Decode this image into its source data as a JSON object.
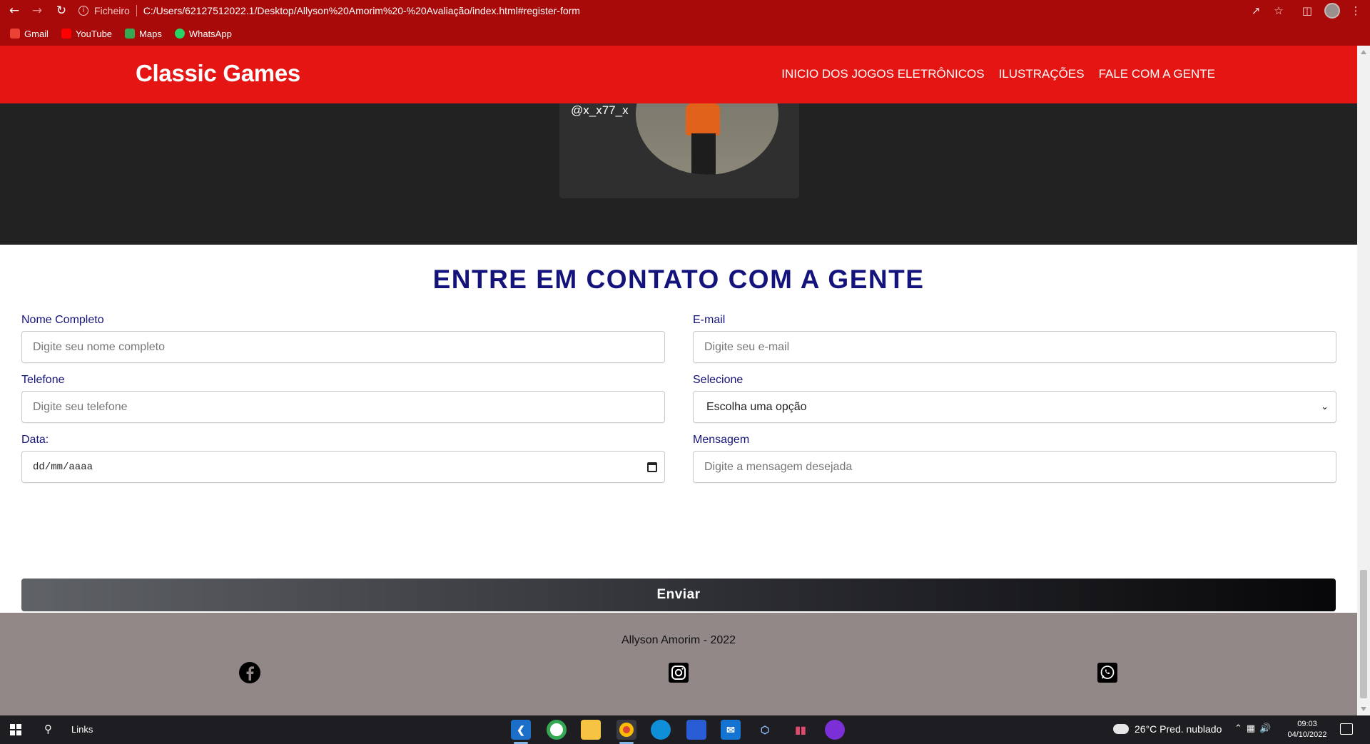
{
  "browser": {
    "scheme_label": "Ficheiro",
    "url": "C:/Users/62127512022.1/Desktop/Allyson%20Amorim%20-%20Avaliação/index.html#register-form",
    "bookmarks": [
      {
        "label": "Gmail",
        "color": "#ea4335"
      },
      {
        "label": "YouTube",
        "color": "#ff0000"
      },
      {
        "label": "Maps",
        "color": "#34a853"
      },
      {
        "label": "WhatsApp",
        "color": "#25d366"
      }
    ]
  },
  "header": {
    "brand": "Classic Games",
    "menu": [
      "INICIO DOS JOGOS ELETRÔNICOS",
      "ILUSTRAÇÕES",
      "FALE COM A GENTE"
    ]
  },
  "profile_card": {
    "handle": "@x_x77_x"
  },
  "contact": {
    "title": "ENTRE EM CONTATO COM A GENTE",
    "fields": {
      "name": {
        "label": "Nome Completo",
        "placeholder": "Digite seu nome completo"
      },
      "email": {
        "label": "E-mail",
        "placeholder": "Digite seu e-mail"
      },
      "phone": {
        "label": "Telefone",
        "placeholder": "Digite seu telefone"
      },
      "select": {
        "label": "Selecione",
        "value": "Escolha uma opção"
      },
      "date": {
        "label": "Data:",
        "value": "dd/mm/aaaa"
      },
      "message": {
        "label": "Mensagem",
        "placeholder": "Digite a mensagem desejada"
      }
    },
    "submit_label": "Enviar"
  },
  "footer": {
    "copyright": "Allyson Amorim - 2022",
    "social": [
      "facebook-icon",
      "instagram-icon",
      "whatsapp-icon"
    ]
  },
  "taskbar": {
    "search_label": "Links",
    "weather": "26°C  Pred. nublado",
    "time": "09:03",
    "date": "04/10/2022"
  },
  "colors": {
    "header_red": "#e51513",
    "chrome_red": "#a80a0a",
    "title_navy": "#14137b",
    "footer_gray": "#928888",
    "dark_section": "#222222"
  }
}
